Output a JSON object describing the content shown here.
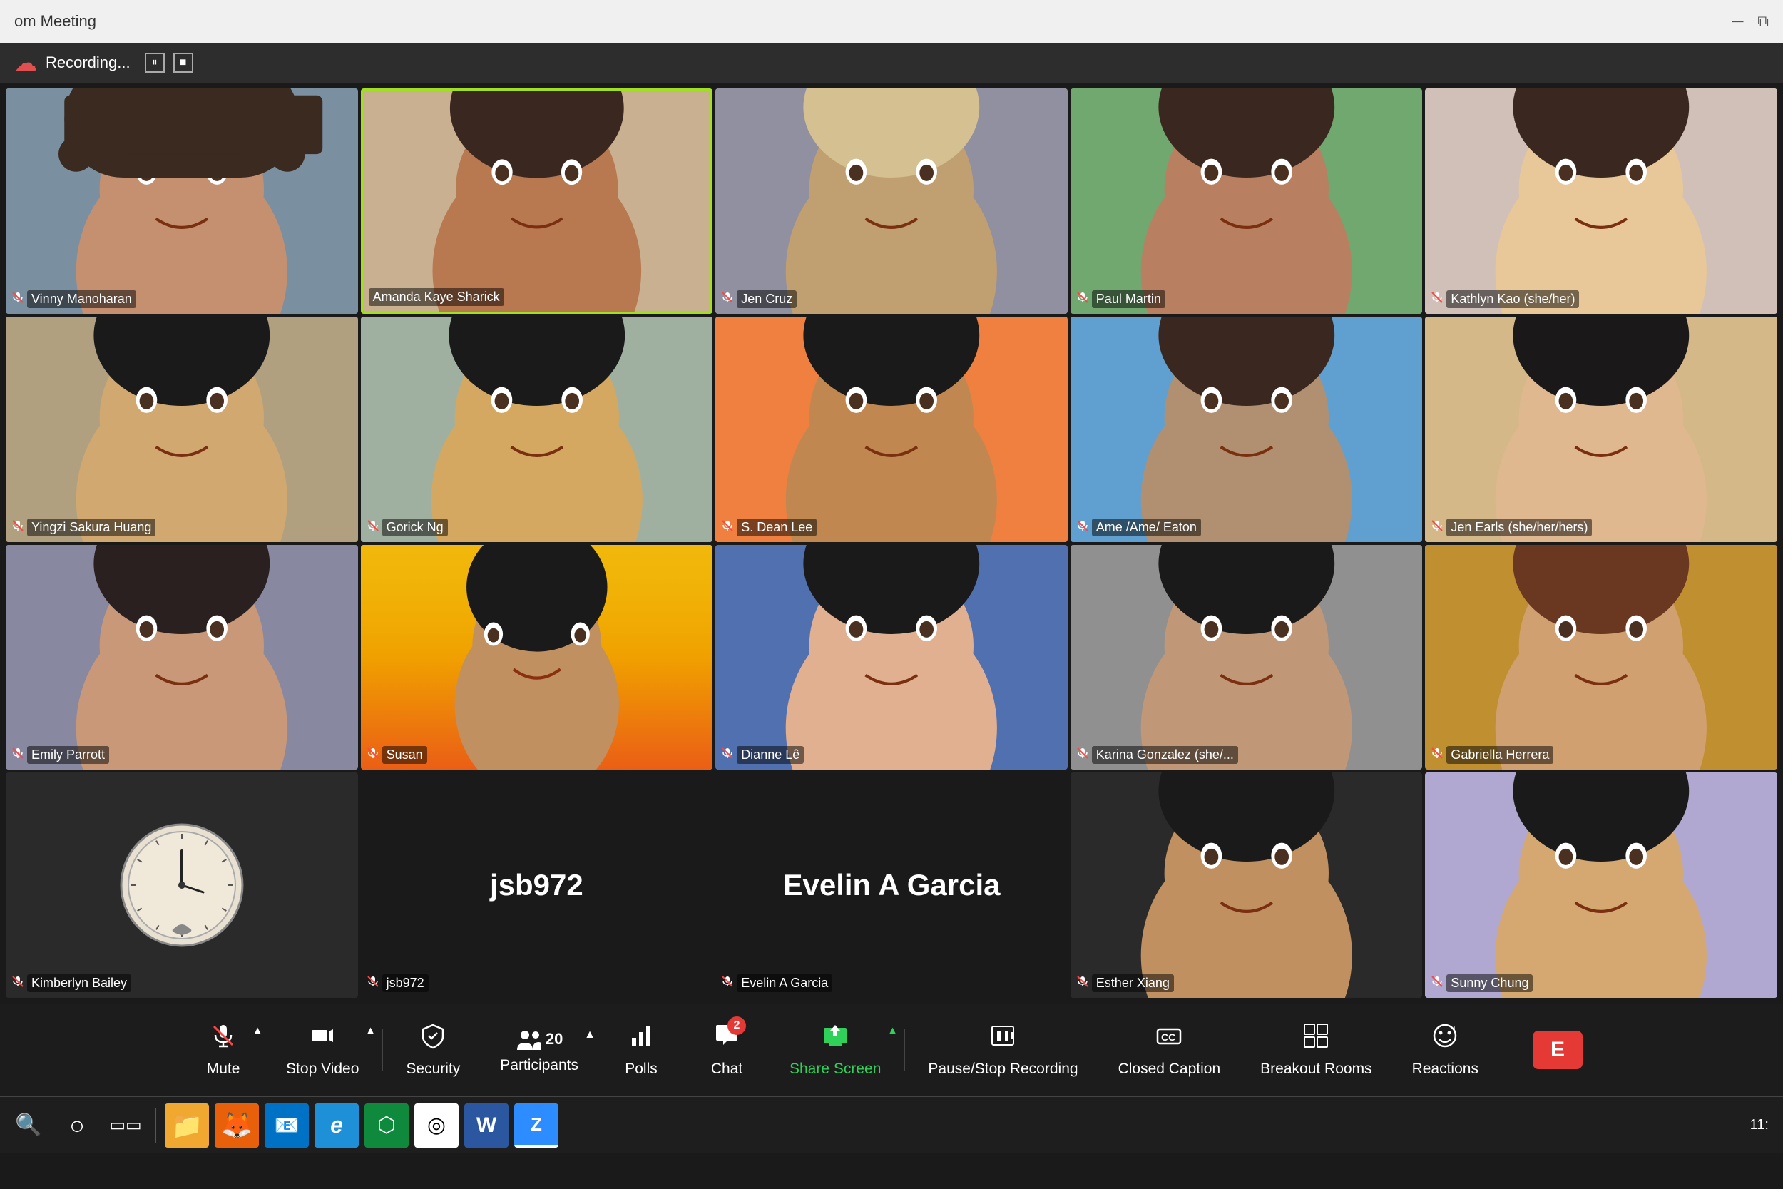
{
  "window": {
    "title": "om Meeting",
    "controls": [
      "minimize",
      "restore"
    ]
  },
  "recording": {
    "text": "Recording...",
    "icon": "☁"
  },
  "participants": [
    {
      "id": "vinny",
      "name": "Vinny Manoharan",
      "muted": true,
      "active": false,
      "type": "video",
      "bg": "cell-vinny"
    },
    {
      "id": "amanda",
      "name": "Amanda Kaye Sharick",
      "muted": false,
      "active": true,
      "type": "video",
      "bg": "cell-amanda"
    },
    {
      "id": "jen",
      "name": "Jen Cruz",
      "muted": true,
      "active": false,
      "type": "video",
      "bg": "cell-jen"
    },
    {
      "id": "paul",
      "name": "Paul Martin",
      "muted": true,
      "active": false,
      "type": "video",
      "bg": "cell-paul"
    },
    {
      "id": "kathlyn",
      "name": "Kathlyn Kao (she/her)",
      "muted": true,
      "active": false,
      "type": "video",
      "bg": "cell-kathlyn"
    },
    {
      "id": "yingzi",
      "name": "Yingzi Sakura Huang",
      "muted": true,
      "active": false,
      "type": "video",
      "bg": "cell-yingzi"
    },
    {
      "id": "gorick",
      "name": "Gorick Ng",
      "muted": true,
      "active": false,
      "type": "video",
      "bg": "cell-gorick"
    },
    {
      "id": "sdean",
      "name": "S. Dean Lee",
      "muted": true,
      "active": false,
      "type": "video",
      "bg": "cell-sdean"
    },
    {
      "id": "ame",
      "name": "Ame /Ame/ Eaton",
      "muted": true,
      "active": false,
      "type": "video",
      "bg": "cell-ame"
    },
    {
      "id": "jenearls",
      "name": "Jen Earls (she/her/hers)",
      "muted": true,
      "active": false,
      "type": "video",
      "bg": "cell-jenearls"
    },
    {
      "id": "emily",
      "name": "Emily Parrott",
      "muted": true,
      "active": false,
      "type": "video",
      "bg": "cell-emily"
    },
    {
      "id": "susan",
      "name": "Susan",
      "muted": true,
      "active": false,
      "type": "video",
      "bg": "cell-susan"
    },
    {
      "id": "dianne",
      "name": "Dianne Lê",
      "muted": true,
      "active": false,
      "type": "video",
      "bg": "cell-dianne"
    },
    {
      "id": "karina",
      "name": "Karina Gonzalez (she/...",
      "muted": true,
      "active": false,
      "type": "video",
      "bg": "cell-karina"
    },
    {
      "id": "gabriella",
      "name": "Gabriella Herrera",
      "muted": true,
      "active": false,
      "type": "video",
      "bg": "cell-gabriella"
    },
    {
      "id": "kimberly",
      "name": "Kimberlyn Bailey",
      "muted": true,
      "active": false,
      "type": "clock",
      "bg": "cell-kimberly"
    },
    {
      "id": "jsb",
      "name": "jsb972",
      "muted": true,
      "active": false,
      "type": "text",
      "bg": "cell-jsb"
    },
    {
      "id": "evelin",
      "name": "Evelin A Garcia",
      "muted": true,
      "active": false,
      "type": "text",
      "bg": "cell-evelin"
    },
    {
      "id": "esther",
      "name": "Esther Xiang",
      "muted": true,
      "active": false,
      "type": "video",
      "bg": "cell-esther"
    },
    {
      "id": "sunny",
      "name": "Sunny Chung",
      "muted": true,
      "active": false,
      "type": "video",
      "bg": "cell-sunny"
    }
  ],
  "toolbar": {
    "items": [
      {
        "id": "mute",
        "icon": "🎤",
        "label": "Mute",
        "caret": true,
        "badge": null,
        "green": false
      },
      {
        "id": "stop-video",
        "icon": "📷",
        "label": "Stop Video",
        "caret": true,
        "badge": null,
        "green": false
      },
      {
        "id": "security",
        "icon": "🛡",
        "label": "Security",
        "caret": false,
        "badge": null,
        "green": false
      },
      {
        "id": "participants",
        "icon": "👥",
        "label": "Participants",
        "caret": true,
        "badge": null,
        "green": false,
        "count": "20"
      },
      {
        "id": "polls",
        "icon": "📊",
        "label": "Polls",
        "caret": false,
        "badge": null,
        "green": false
      },
      {
        "id": "chat",
        "icon": "💬",
        "label": "Chat",
        "caret": false,
        "badge": "2",
        "green": false
      },
      {
        "id": "share-screen",
        "icon": "⬆",
        "label": "Share Screen",
        "caret": true,
        "badge": null,
        "green": true
      },
      {
        "id": "recording",
        "icon": "⏸",
        "label": "Pause/Stop Recording",
        "caret": false,
        "badge": null,
        "green": false
      },
      {
        "id": "captions",
        "icon": "CC",
        "label": "Closed Caption",
        "caret": false,
        "badge": null,
        "green": false
      },
      {
        "id": "breakout",
        "icon": "⊞",
        "label": "Breakout Rooms",
        "caret": false,
        "badge": null,
        "green": false
      },
      {
        "id": "reactions",
        "icon": "😀",
        "label": "Reactions",
        "caret": false,
        "badge": null,
        "green": false
      },
      {
        "id": "end",
        "icon": "E",
        "label": "",
        "caret": false,
        "badge": null,
        "green": false,
        "red": true
      }
    ]
  },
  "taskbar": {
    "items": [
      {
        "id": "search",
        "icon": "🔍",
        "label": "Search"
      },
      {
        "id": "cortana",
        "icon": "○",
        "label": "Cortana"
      },
      {
        "id": "task-view",
        "icon": "▭▭",
        "label": "Task View"
      },
      {
        "id": "explorer",
        "icon": "📁",
        "label": "File Explorer"
      },
      {
        "id": "firefox",
        "icon": "🦊",
        "label": "Firefox"
      },
      {
        "id": "outlook",
        "icon": "📧",
        "label": "Outlook"
      },
      {
        "id": "edge-legacy",
        "icon": "e",
        "label": "Edge Legacy"
      },
      {
        "id": "edge",
        "icon": "⬡",
        "label": "Edge"
      },
      {
        "id": "chrome",
        "icon": "◎",
        "label": "Chrome"
      },
      {
        "id": "word",
        "icon": "W",
        "label": "Word"
      },
      {
        "id": "zoom",
        "icon": "Z",
        "label": "Zoom"
      },
      {
        "id": "time",
        "icon": "",
        "label": "11:"
      }
    ]
  }
}
